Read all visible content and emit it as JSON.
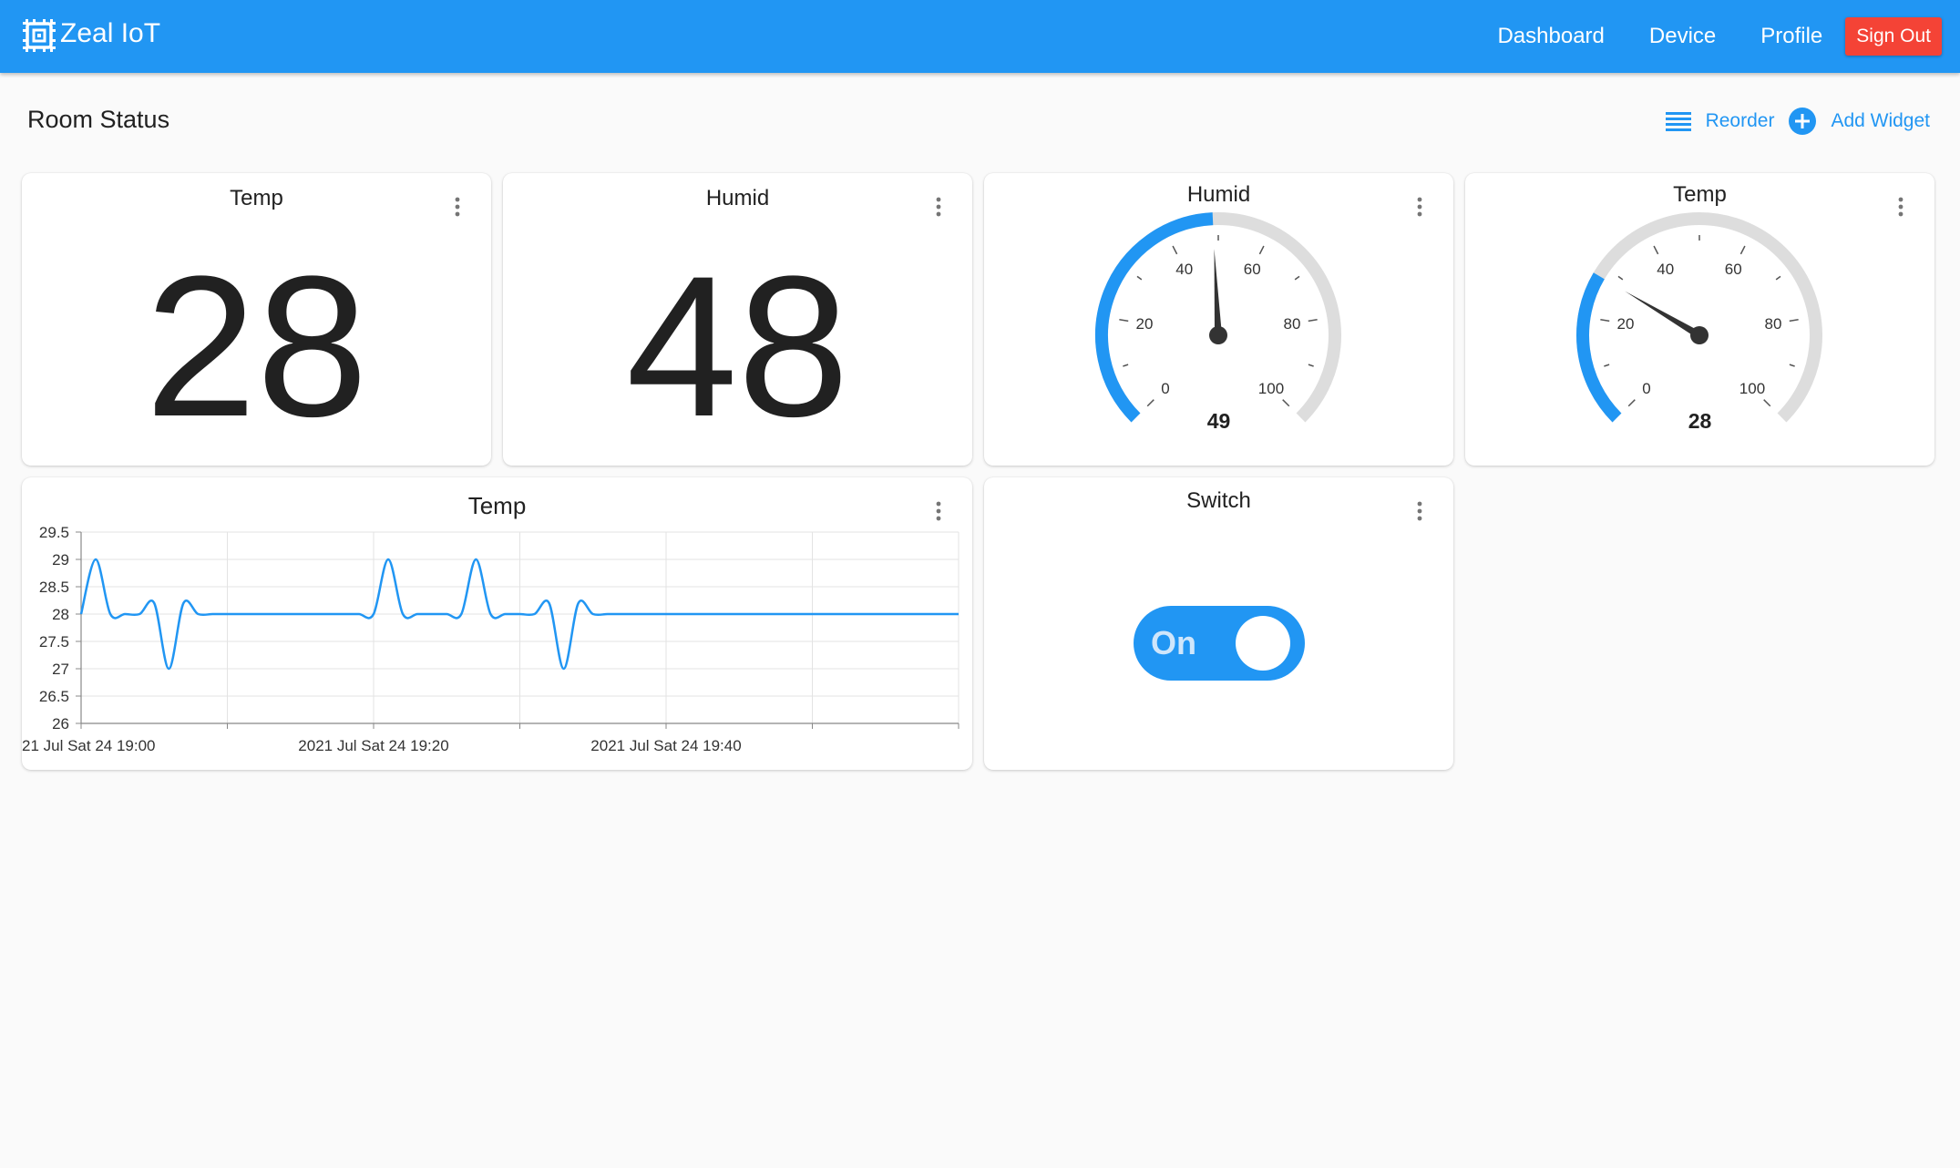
{
  "app": {
    "title": "Zeal IoT",
    "logo_icon": "chip-icon"
  },
  "nav": {
    "dashboard": "Dashboard",
    "device": "Device",
    "profile": "Profile",
    "sign_out": "Sign Out"
  },
  "page": {
    "title": "Room Status",
    "reorder": "Reorder",
    "add_widget": "Add Widget"
  },
  "colors": {
    "primary": "#2196f3",
    "danger": "#f44336",
    "gauge_track": "#dddddd"
  },
  "widgets": {
    "temp_value": {
      "title": "Temp",
      "value": "28"
    },
    "humid_value": {
      "title": "Humid",
      "value": "48"
    },
    "humid_gauge": {
      "title": "Humid",
      "value": 49,
      "display": "49",
      "min": 0,
      "max": 100,
      "tick_labels": [
        "0",
        "20",
        "40",
        "60",
        "80",
        "100"
      ]
    },
    "temp_gauge": {
      "title": "Temp",
      "value": 28,
      "display": "28",
      "min": 0,
      "max": 100,
      "tick_labels": [
        "0",
        "20",
        "40",
        "60",
        "80",
        "100"
      ]
    },
    "temp_chart": {
      "title": "Temp"
    },
    "switch": {
      "title": "Switch",
      "state": "On"
    }
  },
  "chart_data": {
    "type": "line",
    "title": "Temp",
    "xlabel": "",
    "ylabel": "",
    "ylim": [
      26,
      29.5
    ],
    "y_ticks": [
      "29.5",
      "29",
      "28.5",
      "28",
      "27.5",
      "27",
      "26.5",
      "26"
    ],
    "x_tick_labels": [
      "21 Jul Sat 24 19:00",
      "2021 Jul Sat 24 19:20",
      "2021 Jul Sat 24 19:40"
    ],
    "x_minutes": [
      0,
      1,
      2,
      3,
      4,
      5,
      6,
      7,
      8,
      9,
      10,
      11,
      12,
      13,
      14,
      15,
      16,
      17,
      18,
      19,
      20,
      21,
      22,
      23,
      24,
      25,
      26,
      27,
      28,
      29,
      30,
      31,
      32,
      33,
      34,
      35,
      36,
      37,
      38,
      39,
      40,
      41,
      42,
      43,
      44,
      45,
      46,
      47,
      48,
      49,
      50,
      51,
      52,
      53,
      54,
      55,
      56,
      57,
      58,
      59,
      60
    ],
    "y": [
      28,
      29,
      28,
      28,
      28,
      28.2,
      27,
      28.2,
      28,
      28,
      28,
      28,
      28,
      28,
      28,
      28,
      28,
      28,
      28,
      28,
      28,
      29,
      28,
      28,
      28,
      28,
      28,
      29,
      28,
      28,
      28,
      28,
      28.2,
      27,
      28.2,
      28,
      28,
      28,
      28,
      28,
      28,
      28,
      28,
      28,
      28,
      28,
      28,
      28,
      28,
      28,
      28,
      28,
      28,
      28,
      28,
      28,
      28,
      28,
      28,
      28,
      28
    ],
    "grid": true,
    "series": [
      {
        "name": "",
        "color": "#2196f3"
      }
    ]
  }
}
